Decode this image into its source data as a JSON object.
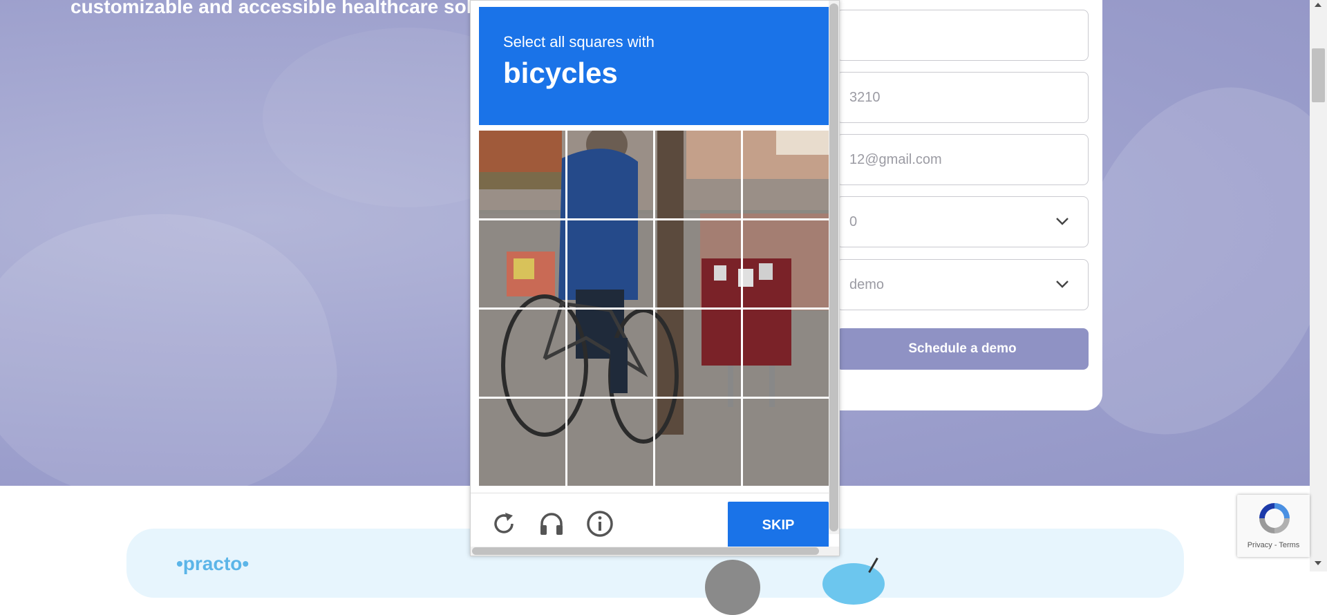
{
  "hero": {
    "tagline": "customizable and accessible healthcare solu"
  },
  "form": {
    "fields": [
      {
        "value": ""
      },
      {
        "value": "3210"
      },
      {
        "value": "12@gmail.com"
      },
      {
        "value": "0",
        "dropdown": true
      },
      {
        "value": "demo",
        "dropdown": true
      }
    ],
    "submit_label": "Schedule a demo"
  },
  "brand": {
    "name": "•practo•"
  },
  "recaptcha_badge": {
    "links": "Privacy - Terms"
  },
  "captcha": {
    "instruction": "Select all squares with",
    "target": "bicycles",
    "skip_label": "SKIP",
    "grid": {
      "rows": 4,
      "cols": 4
    },
    "icons": [
      "reload-icon",
      "audio-icon",
      "info-icon"
    ]
  },
  "colors": {
    "captcha_blue": "#1a73e8",
    "hero_purple": "#9a9dcb",
    "button_purple": "#8f92c4"
  }
}
